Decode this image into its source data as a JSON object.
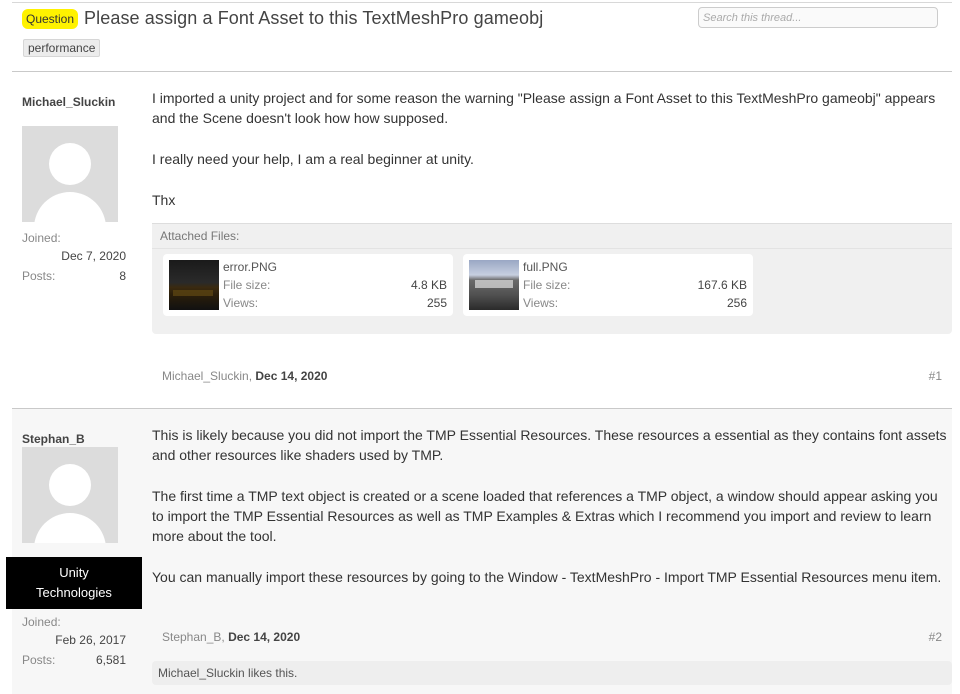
{
  "thread": {
    "prefix": "Question",
    "title": "Please assign a Font Asset to this TextMeshPro gameobj",
    "tag": "performance"
  },
  "search": {
    "placeholder": "Search this thread..."
  },
  "posts": [
    {
      "username": "Michael_Sluckin",
      "joined_label": "Joined:",
      "joined": "Dec 7, 2020",
      "posts_label": "Posts:",
      "post_count": "8",
      "paragraphs": [
        "I imported a unity project and for some reason the warning \"Please assign a Font Asset to this TextMeshPro gameobj\" appears and the Scene doesn't look how how supposed.",
        "I really need your help, I am a real beginner at unity.",
        "Thx"
      ],
      "attachments_header": "Attached Files:",
      "attachments": [
        {
          "name": "error.PNG",
          "size_label": "File size:",
          "size": "4.8 KB",
          "views_label": "Views:",
          "views": "255"
        },
        {
          "name": "full.PNG",
          "size_label": "File size:",
          "size": "167.6 KB",
          "views_label": "Views:",
          "views": "256"
        }
      ],
      "author": "Michael_Sluckin",
      "date": "Dec 14, 2020",
      "number": "#1"
    },
    {
      "username": "Stephan_B",
      "banner_line1": "Unity",
      "banner_line2": "Technologies",
      "joined_label": "Joined:",
      "joined": "Feb 26, 2017",
      "posts_label": "Posts:",
      "post_count": "6,581",
      "paragraphs": [
        "This is likely because you did not import the TMP Essential Resources. These resources a essential as they contains font assets and other resources like shaders used by TMP.",
        "The first time a TMP text object is created or a scene loaded that references a TMP object, a window should appear asking you to import the TMP Essential Resources as well as TMP Examples & Extras which I recommend you import and review to learn more about the tool.",
        "You can manually import these resources by going to the Window - TextMeshPro - Import TMP Essential Resources menu item."
      ],
      "author": "Stephan_B",
      "date": "Dec 14, 2020",
      "number": "#2",
      "likes": "Michael_Sluckin likes this."
    }
  ]
}
